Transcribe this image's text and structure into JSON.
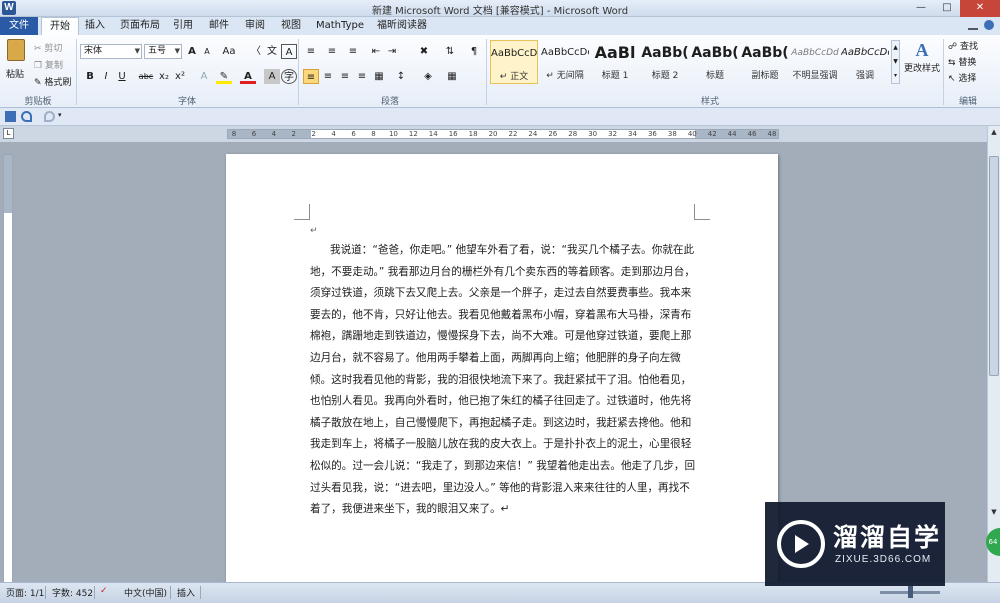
{
  "window": {
    "title": "新建 Microsoft Word 文档 [兼容模式] - Microsoft Word",
    "app_icon": "W"
  },
  "tabs": [
    {
      "label": "文件"
    },
    {
      "label": "开始"
    },
    {
      "label": "插入"
    },
    {
      "label": "页面布局"
    },
    {
      "label": "引用"
    },
    {
      "label": "邮件"
    },
    {
      "label": "审阅"
    },
    {
      "label": "视图"
    },
    {
      "label": "MathType"
    },
    {
      "label": "福昕阅读器"
    }
  ],
  "ribbon": {
    "clipboard": {
      "paste": "粘贴",
      "cut": "剪切",
      "copy": "复制",
      "format_painter": "格式刷",
      "group": "剪贴板"
    },
    "font": {
      "family": "宋体",
      "size": "五号",
      "group": "字体",
      "size_up": "A",
      "size_down": "A",
      "change_case": "Aa",
      "clear": "A",
      "bold": "B",
      "italic": "I",
      "underline": "U",
      "strike": "abc",
      "sub": "x₂",
      "sup": "x²",
      "color": "A",
      "char_shade": "A"
    },
    "paragraph": {
      "group": "段落"
    },
    "styles": {
      "group": "样式",
      "items": [
        {
          "sample": "AaBbCcDd",
          "name": "↵ 正文"
        },
        {
          "sample": "AaBbCcDd",
          "name": "↵ 无间隔"
        },
        {
          "sample": "AaBl",
          "name": "标题 1"
        },
        {
          "sample": "AaBb(",
          "name": "标题 2"
        },
        {
          "sample": "AaBb(",
          "name": "标题"
        },
        {
          "sample": "AaBb(",
          "name": "副标题"
        },
        {
          "sample": "AaBbCcDd",
          "name": "不明显强调"
        },
        {
          "sample": "AaBbCcDd",
          "name": "强调"
        }
      ],
      "change_styles": "更改样式"
    },
    "editing": {
      "group": "编辑",
      "find": "查找",
      "replace": "替换",
      "select": "选择"
    }
  },
  "ruler": {
    "ticks": [
      "8",
      "6",
      "4",
      "2",
      "2",
      "4",
      "6",
      "8",
      "10",
      "12",
      "14",
      "16",
      "18",
      "20",
      "22",
      "24",
      "26",
      "28",
      "30",
      "32",
      "34",
      "36",
      "38",
      "40",
      "42",
      "44",
      "46",
      "48"
    ]
  },
  "document": {
    "paragraph": "我说道：“爸爸，你走吧。” 他望车外看了看，说：“我买几个橘子去。你就在此地，不要走动。” 我看那边月台的栅栏外有几个卖东西的等着顾客。走到那边月台，须穿过铁道，须跳下去又爬上去。父亲是一个胖子，走过去自然要费事些。我本来要去的，他不肯，只好让他去。我看见他戴着黑布小帽，穿着黑布大马褂，深青布棉袍，蹒跚地走到铁道边，慢慢探身下去，尚不大难。可是他穿过铁道，要爬上那边月台，就不容易了。他用两手攀着上面，两脚再向上缩；他肥胖的身子向左微倾。这时我看见他的背影，我的泪很快地流下来了。我赶紧拭干了泪。怕他看见，也怕别人看见。我再向外看时，他已抱了朱红的橘子往回走了。过铁道时，他先将橘子散放在地上，自己慢慢爬下，再抱起橘子走。到这边时，我赶紧去搀他。他和我走到车上，将橘子一股脑儿放在我的皮大衣上。于是扑扑衣上的泥土，心里很轻松似的。过一会儿说：“我走了，到那边来信！” 我望着他走出去。他走了几步，回过头看见我，说：“进去吧，里边没人。” 等他的背影混入来来往往的人里，再找不着了，我便进来坐下，我的眼泪又来了。↵",
    "para_mark": "↵"
  },
  "status": {
    "page": "页面: 1/1",
    "words": "字数: 452",
    "lang": "中文(中国)",
    "mode": "插入"
  },
  "watermark": {
    "cn": "溜溜自学",
    "en": "ZIXUE.3D66.COM"
  },
  "colors": {
    "file_tab": "#2a5aa6",
    "close": "#c7463a",
    "watermark_bg": "#121c30"
  }
}
